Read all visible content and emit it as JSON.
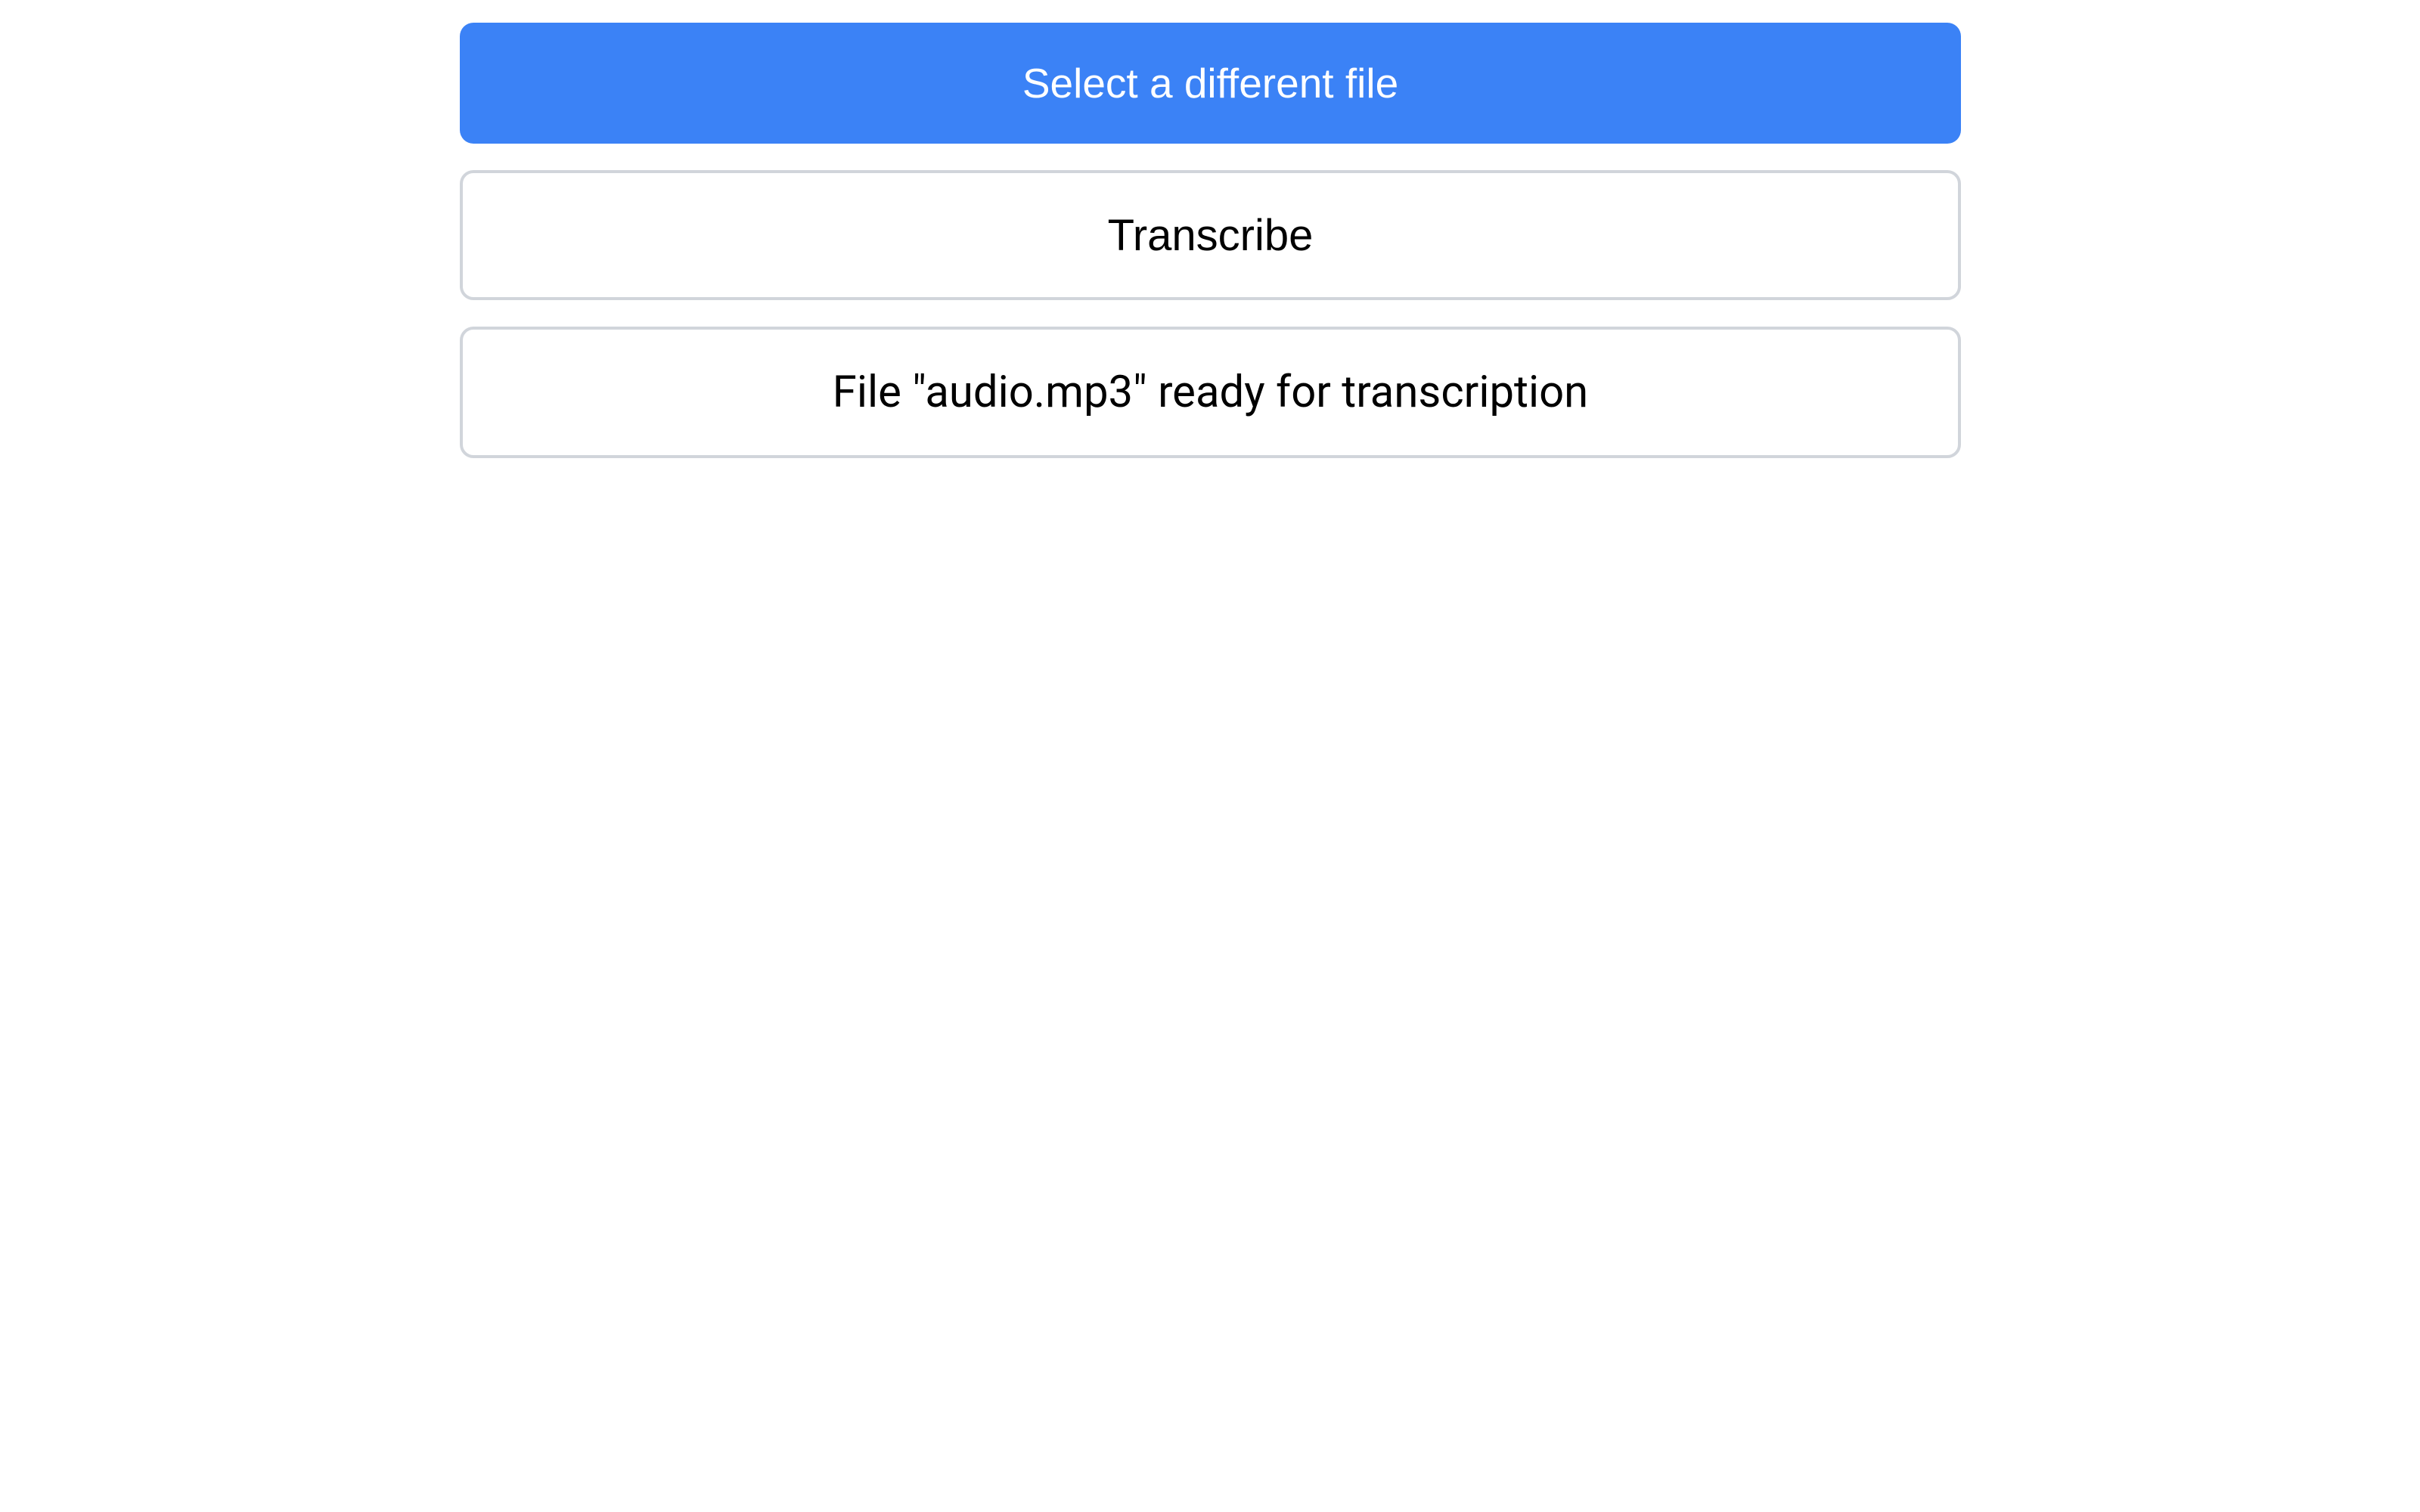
{
  "buttons": {
    "select_file": "Select a different file",
    "transcribe": "Transcribe"
  },
  "status": {
    "message": "File \"audio.mp3\" ready for transcription"
  }
}
